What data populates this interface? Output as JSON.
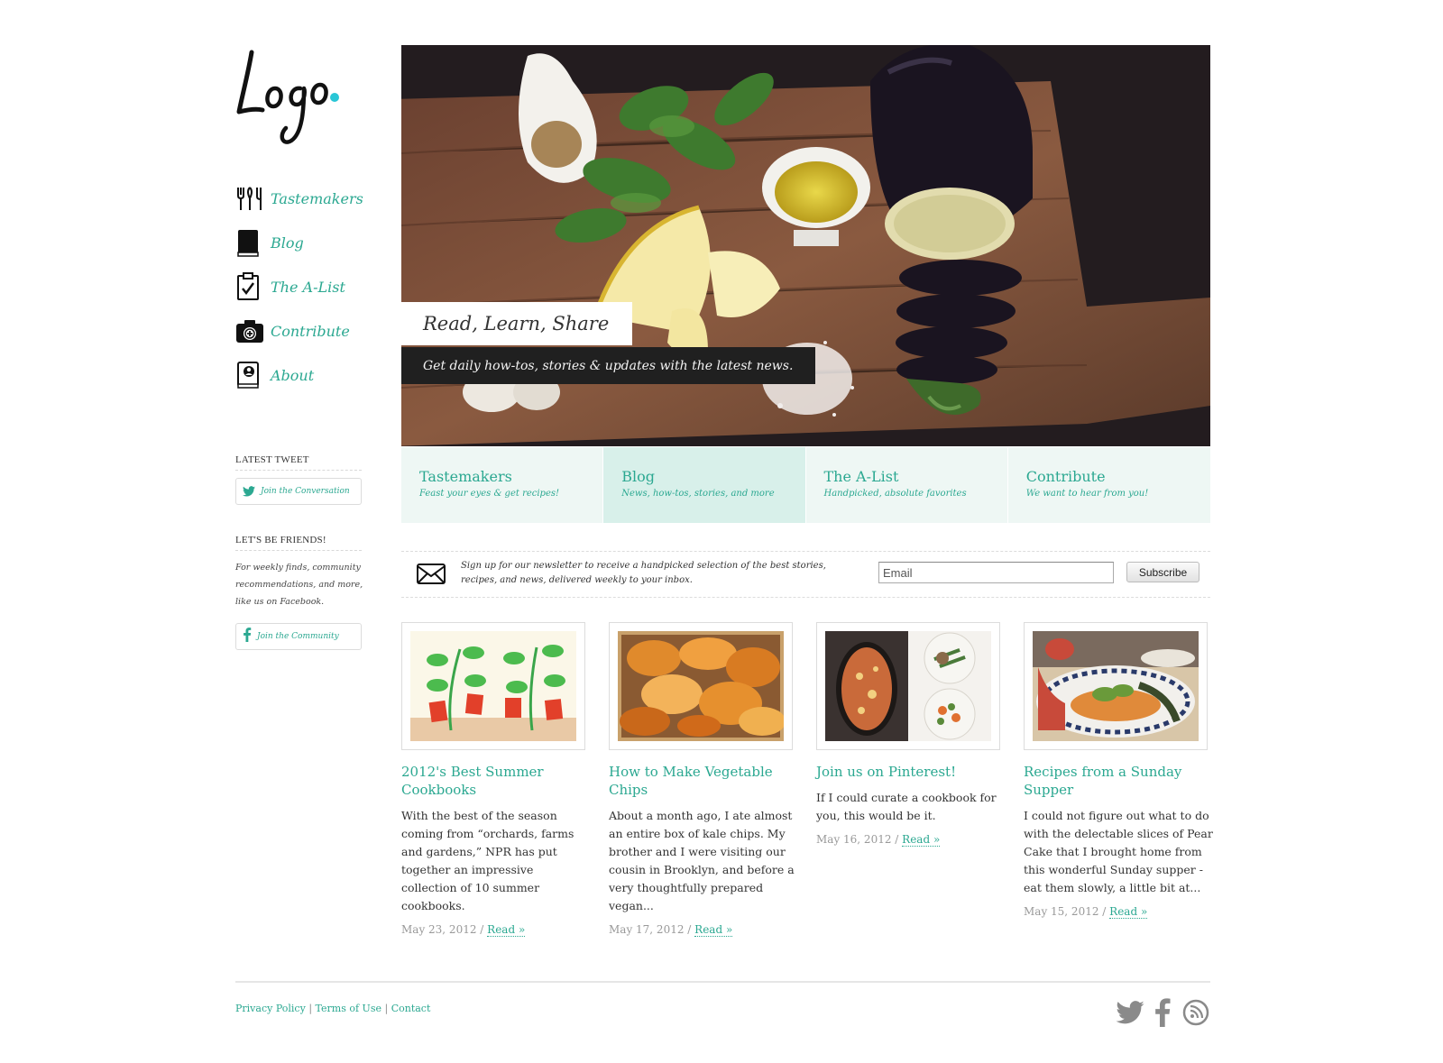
{
  "brand": {
    "logo_text": "Logo",
    "accent_color": "#2ba891",
    "dot_color": "#29c6d6"
  },
  "nav": {
    "items": [
      {
        "label": "Tastemakers",
        "icon": "utensils-icon"
      },
      {
        "label": "Blog",
        "icon": "book-icon"
      },
      {
        "label": "The A-List",
        "icon": "clipboard-check-icon"
      },
      {
        "label": "Contribute",
        "icon": "camera-icon"
      },
      {
        "label": "About",
        "icon": "profile-book-icon"
      }
    ]
  },
  "sidebar": {
    "tweet_heading": "LATEST TWEET",
    "tweet_button": "Join the Conversation",
    "friends_heading": "LET'S BE FRIENDS!",
    "friends_text": "For weekly finds, community recommendations, and more, like us on Facebook.",
    "friends_button": "Join the Community"
  },
  "hero": {
    "title": "Read, Learn, Share",
    "subtitle": "Get daily how-tos, stories & updates with the latest news."
  },
  "categories": [
    {
      "title": "Tastemakers",
      "subtitle": "Feast your eyes & get recipes!"
    },
    {
      "title": "Blog",
      "subtitle": "News, how-tos, stories, and more"
    },
    {
      "title": "The A-List",
      "subtitle": "Handpicked, absolute favorites"
    },
    {
      "title": "Contribute",
      "subtitle": "We want to hear from you!"
    }
  ],
  "newsletter": {
    "text": "Sign up for our newsletter to receive a handpicked selection of the best stories, recipes, and news, delivered weekly to your inbox.",
    "placeholder": "Email",
    "button": "Subscribe"
  },
  "posts": [
    {
      "title": "2012's Best Summer Cookbooks",
      "excerpt": "With the best of the season coming from “orchards, farms and gardens,” NPR has put together an impressive collection of 10 summer cookbooks.",
      "date": "May 23, 2012",
      "read": "Read »"
    },
    {
      "title": "How to Make Vegetable Chips",
      "excerpt": "About a month ago, I ate almost an entire box of kale chips. My brother and I were visiting our cousin in Brooklyn, and before a very thoughtfully prepared vegan...",
      "date": "May 17, 2012",
      "read": "Read »"
    },
    {
      "title": "Join us on Pinterest!",
      "excerpt": "If I could curate a cookbook for you, this would be it.",
      "date": "May 16, 2012",
      "read": "Read »"
    },
    {
      "title": "Recipes from a Sunday Supper",
      "excerpt": "I could not figure out what to do with the delectable slices of Pear Cake that I brought home from this wonderful Sunday supper - eat them slowly, a little bit at...",
      "date": "May 15, 2012",
      "read": "Read »"
    }
  ],
  "footer": {
    "links": [
      "Privacy Policy",
      "Terms of Use",
      "Contact"
    ],
    "separator": "|",
    "meta_separator": " / ",
    "social": [
      "twitter-bird-icon",
      "facebook-icon",
      "rss-icon"
    ]
  }
}
